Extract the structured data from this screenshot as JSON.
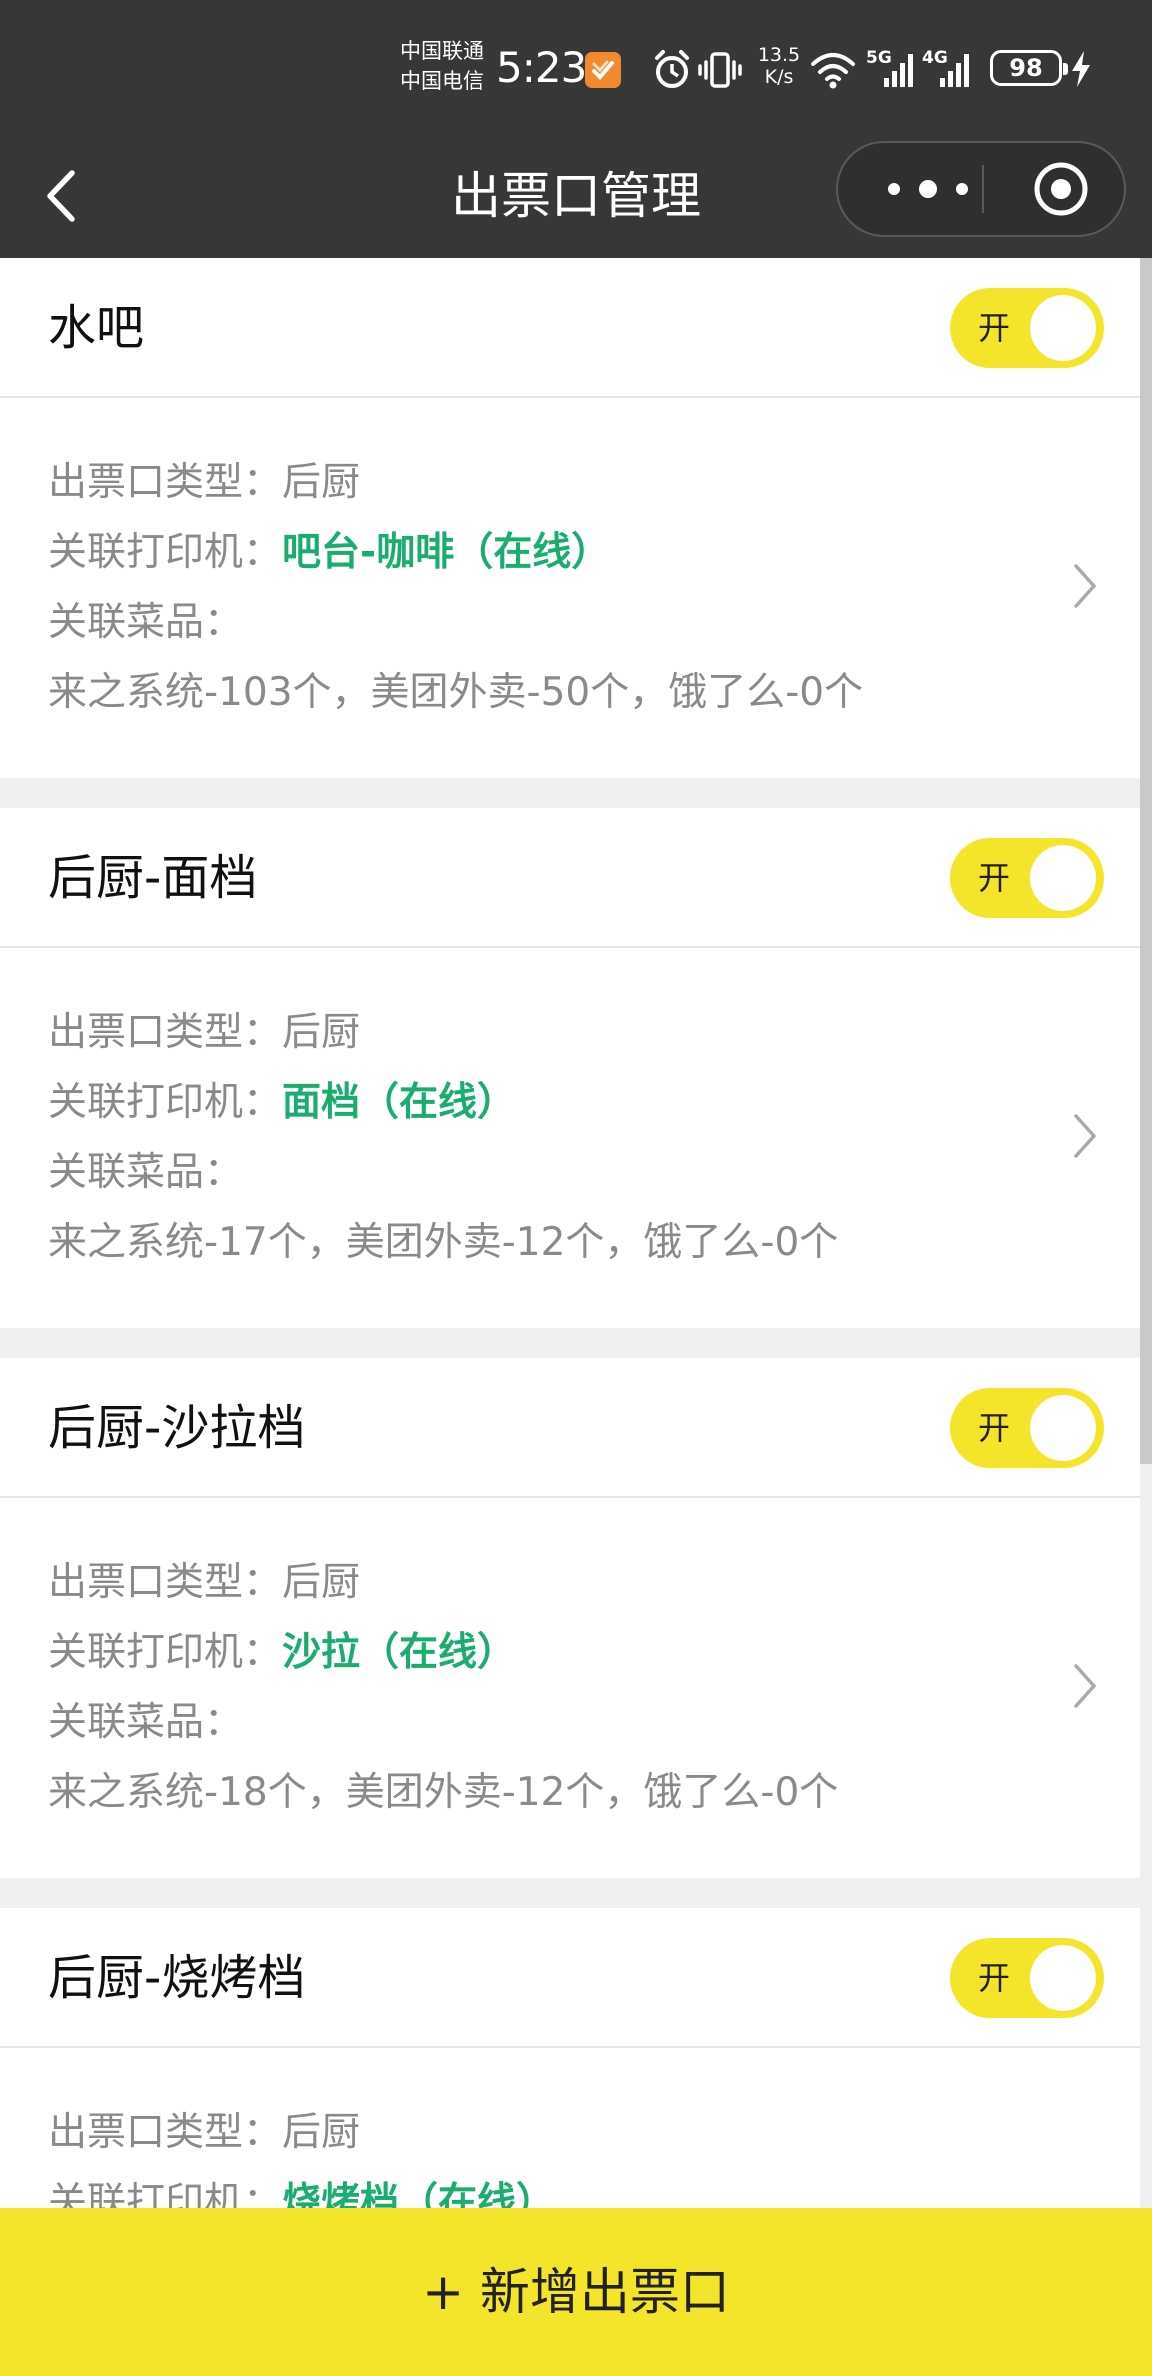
{
  "status_bar": {
    "carrier_1": "中国联通",
    "carrier_2": "中国电信",
    "time": "5:23",
    "net_speed_value": "13.5",
    "net_speed_unit": "K/s",
    "signal_1_label": "5G",
    "signal_2_label": "4G",
    "battery": "98"
  },
  "nav": {
    "title": "出票口管理"
  },
  "labels": {
    "type": "出票口类型：",
    "printer": "关联打印机：",
    "dishes": "关联菜品："
  },
  "cards": [
    {
      "title": "水吧",
      "toggle_label": "开",
      "type_value": "后厨",
      "printer_value": "吧台-咖啡（在线）",
      "dishes_value": "来之系统-103个，美团外卖-50个，饿了么-0个"
    },
    {
      "title": "后厨-面档",
      "toggle_label": "开",
      "type_value": "后厨",
      "printer_value": "面档（在线）",
      "dishes_value": "来之系统-17个，美团外卖-12个，饿了么-0个"
    },
    {
      "title": "后厨-沙拉档",
      "toggle_label": "开",
      "type_value": "后厨",
      "printer_value": "沙拉（在线）",
      "dishes_value": "来之系统-18个，美团外卖-12个，饿了么-0个"
    },
    {
      "title": "后厨-烧烤档",
      "toggle_label": "开",
      "type_value": "后厨",
      "printer_value": "烧烤档（在线）",
      "dishes_value": ""
    }
  ],
  "footer": {
    "add_button": "+ 新增出票口"
  },
  "colors": {
    "header_bg": "#373737",
    "accent_yellow": "#f4e52b",
    "online_green": "#1aad6e"
  }
}
